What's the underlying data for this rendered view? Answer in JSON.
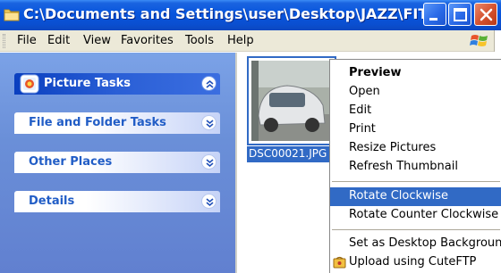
{
  "window": {
    "title": "C:\\Documents and Settings\\user\\Desktop\\JAZZ\\FIT",
    "icon": "folder-icon",
    "controls": [
      "minimize-icon",
      "maximize-icon",
      "close-icon"
    ],
    "title_bar_color": "#0855dd"
  },
  "menubar": {
    "items": [
      "File",
      "Edit",
      "View",
      "Favorites",
      "Tools",
      "Help"
    ],
    "logo": "windows-logo-icon"
  },
  "taskpane": {
    "background_color": "#6a8fd8",
    "groups": [
      {
        "label": "Picture Tasks",
        "icon": "picture-tasks-icon",
        "chevron": "double-chevron-up-icon"
      },
      {
        "label": "File and Folder Tasks",
        "chevron": "double-chevron-down-icon"
      },
      {
        "label": "Other Places",
        "chevron": "double-chevron-down-icon"
      },
      {
        "label": "Details",
        "chevron": "double-chevron-down-icon"
      }
    ]
  },
  "files": [
    {
      "name": "DSC00021.JPG",
      "selected": true
    }
  ],
  "context_menu": {
    "highlight_color": "#316ac5",
    "items": [
      {
        "label": "Preview",
        "bold": true
      },
      {
        "label": "Open"
      },
      {
        "label": "Edit"
      },
      {
        "label": "Print"
      },
      {
        "label": "Resize Pictures"
      },
      {
        "label": "Refresh Thumbnail"
      },
      {
        "label": "Rotate Clockwise",
        "highlighted": true
      },
      {
        "label": "Rotate Counter Clockwise"
      },
      {
        "label": "Set as Desktop Background"
      },
      {
        "label": "Upload using CuteFTP",
        "icon": "cuteftp-icon"
      }
    ]
  }
}
